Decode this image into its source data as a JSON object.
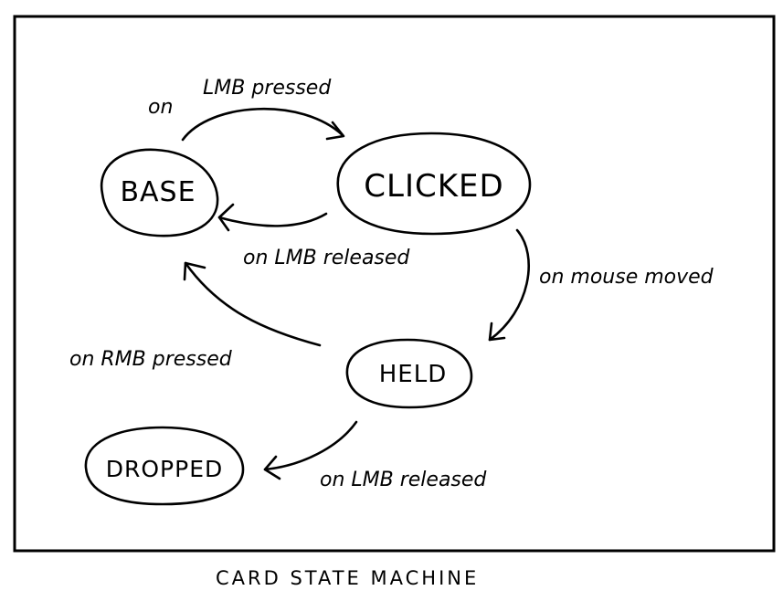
{
  "diagram": {
    "type": "state-machine",
    "caption": "CARD STATE MACHINE",
    "states": [
      {
        "id": "base",
        "label": "BASE"
      },
      {
        "id": "clicked",
        "label": "CLICKED"
      },
      {
        "id": "held",
        "label": "HELD"
      },
      {
        "id": "dropped",
        "label": "DROPPED"
      }
    ],
    "transitions": [
      {
        "from": "base",
        "to": "clicked",
        "label_prefix": "on",
        "label": "LMB pressed"
      },
      {
        "from": "clicked",
        "to": "base",
        "label": "on LMB released"
      },
      {
        "from": "clicked",
        "to": "held",
        "label": "on mouse moved"
      },
      {
        "from": "held",
        "to": "base",
        "label": "on RMB pressed"
      },
      {
        "from": "held",
        "to": "dropped",
        "label": "on LMB released"
      }
    ]
  }
}
